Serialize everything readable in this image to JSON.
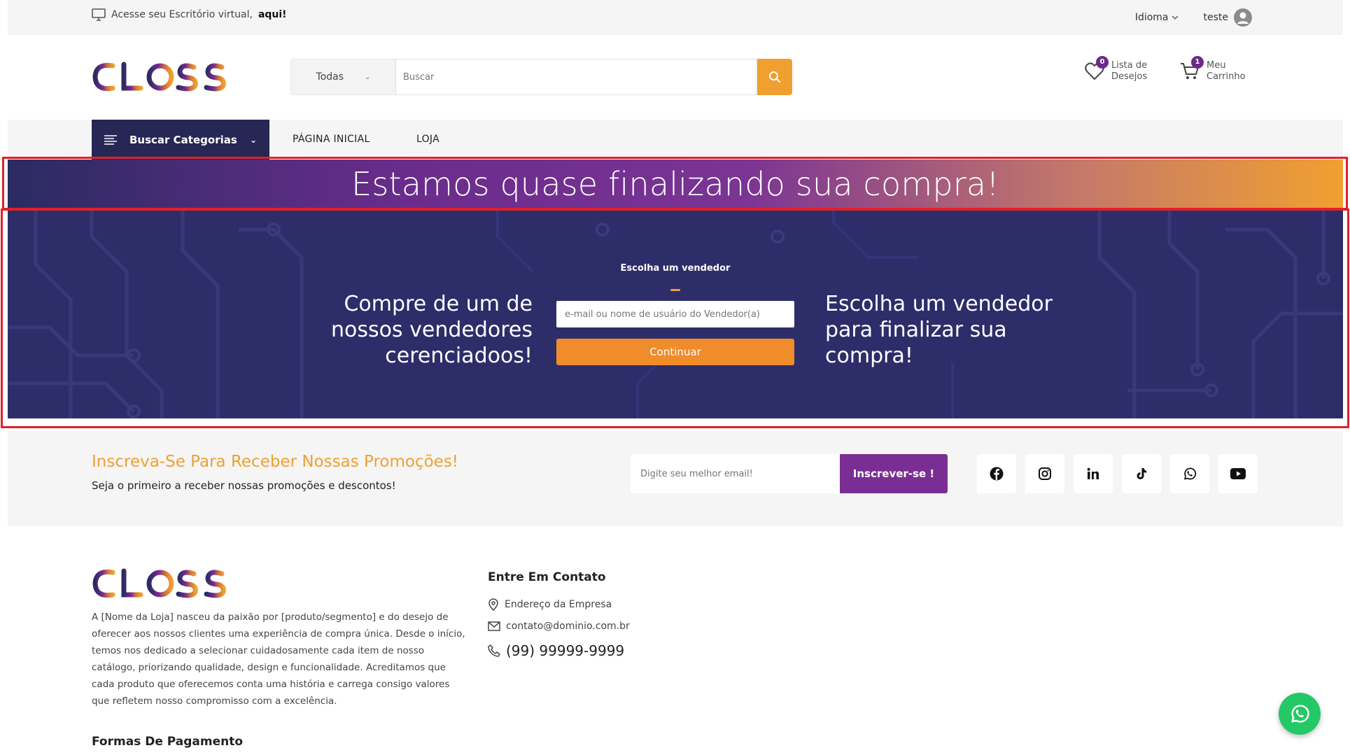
{
  "topbar": {
    "office_text": "Acesse seu Escritório virtual,",
    "office_link": "aqui!",
    "language_label": "Idioma",
    "username": "teste"
  },
  "header": {
    "search_category": "Todas",
    "search_placeholder": "Buscar",
    "wishlist_count": "0",
    "wishlist_label_1": "Lista de",
    "wishlist_label_2": "Desejos",
    "cart_count": "1",
    "cart_label_1": "Meu",
    "cart_label_2": "Carrinho"
  },
  "nav": {
    "categories_label": "Buscar Categorias",
    "links": [
      "PÁGINA INICIAL",
      "LOJA"
    ]
  },
  "banner": {
    "title": "Estamos quase finalizando sua compra!"
  },
  "vendor": {
    "left_text": "Compre de um de nossos vendedores cerenciadoos!",
    "form_label": "Escolha um vendedor",
    "input_placeholder": "e-mail ou nome de usuário do Vendedor(a)",
    "button_label": "Continuar",
    "right_text": "Escolha um vendedor para finalizar sua compra!"
  },
  "newsletter": {
    "title": "Inscreva-Se Para Receber Nossas Promoções!",
    "subtitle": "Seja o primeiro a receber nossas promoções e descontos!",
    "email_placeholder": "Digite seu melhor email!",
    "button_label": "Inscrever-se !"
  },
  "social_icons": [
    "facebook-icon",
    "instagram-icon",
    "linkedin-icon",
    "tiktok-icon",
    "whatsapp-icon",
    "youtube-icon"
  ],
  "footer": {
    "about": "A [Nome da Loja] nasceu da paixão por [produto/segmento] e do desejo de oferecer aos nossos clientes uma experiência de compra única. Desde o início, temos nos dedicado a selecionar cuidadosamente cada item de nosso catálogo, priorizando qualidade, design e funcionalidade. Acreditamos que cada produto que oferecemos conta uma história e carrega consigo valores que refletem nosso compromisso com a excelência.",
    "payment_title": "Formas De Pagamento",
    "contact_title": "Entre Em Contato",
    "address": "Endereço da Empresa",
    "email": "contato@dominio.com.br",
    "phone": "(99) 99999-9999"
  },
  "colors": {
    "navy": "#2d2d6a",
    "purple": "#7a2e93",
    "orange": "#f0a030",
    "highlight_red": "#e0202a",
    "whatsapp_green": "#25c866"
  }
}
